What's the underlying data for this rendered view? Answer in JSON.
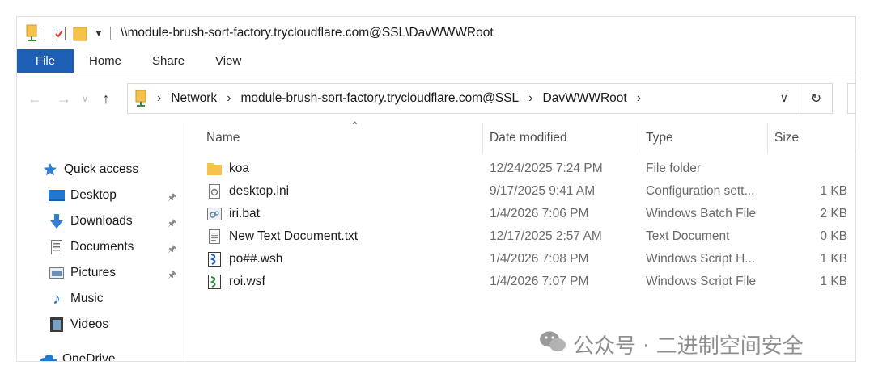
{
  "window": {
    "title": "\\\\module-brush-sort-factory.trycloudflare.com@SSL\\DavWWWRoot"
  },
  "ribbon": {
    "tabs": [
      "File",
      "Home",
      "Share",
      "View"
    ]
  },
  "address": {
    "crumbs": [
      "Network",
      "module-brush-sort-factory.trycloudflare.com@SSL",
      "DavWWWRoot"
    ]
  },
  "nav_pane": {
    "quick_access": "Quick access",
    "items": [
      {
        "label": "Desktop",
        "icon": "desktop-icon",
        "pinned": true
      },
      {
        "label": "Downloads",
        "icon": "downloads-icon",
        "pinned": true
      },
      {
        "label": "Documents",
        "icon": "documents-icon",
        "pinned": true
      },
      {
        "label": "Pictures",
        "icon": "pictures-icon",
        "pinned": true
      },
      {
        "label": "Music",
        "icon": "music-icon",
        "pinned": false
      },
      {
        "label": "Videos",
        "icon": "videos-icon",
        "pinned": false
      }
    ],
    "onedrive": "OneDrive"
  },
  "file_list": {
    "columns": [
      "Name",
      "Date modified",
      "Type",
      "Size"
    ],
    "rows": [
      {
        "name": "koa",
        "date": "12/24/2025 7:24 PM",
        "type": "File folder",
        "size": "",
        "icon": "folder-icon"
      },
      {
        "name": "desktop.ini",
        "date": "9/17/2025 9:41 AM",
        "type": "Configuration sett...",
        "size": "1 KB",
        "icon": "config-file-icon"
      },
      {
        "name": "iri.bat",
        "date": "1/4/2026 7:06 PM",
        "type": "Windows Batch File",
        "size": "2 KB",
        "icon": "batch-file-icon"
      },
      {
        "name": "New Text Document.txt",
        "date": "12/17/2025 2:57 AM",
        "type": "Text Document",
        "size": "0 KB",
        "icon": "text-file-icon"
      },
      {
        "name": "po##.wsh",
        "date": "1/4/2026 7:08 PM",
        "type": "Windows Script H...",
        "size": "1 KB",
        "icon": "script-file-icon"
      },
      {
        "name": "roi.wsf",
        "date": "1/4/2026 7:07 PM",
        "type": "Windows Script File",
        "size": "1 KB",
        "icon": "script-file-icon"
      }
    ]
  },
  "watermark": {
    "text": "公众号 · 二进制空间安全"
  },
  "colors": {
    "accent": "#1e5fb6",
    "folder": "#f5c24c"
  }
}
